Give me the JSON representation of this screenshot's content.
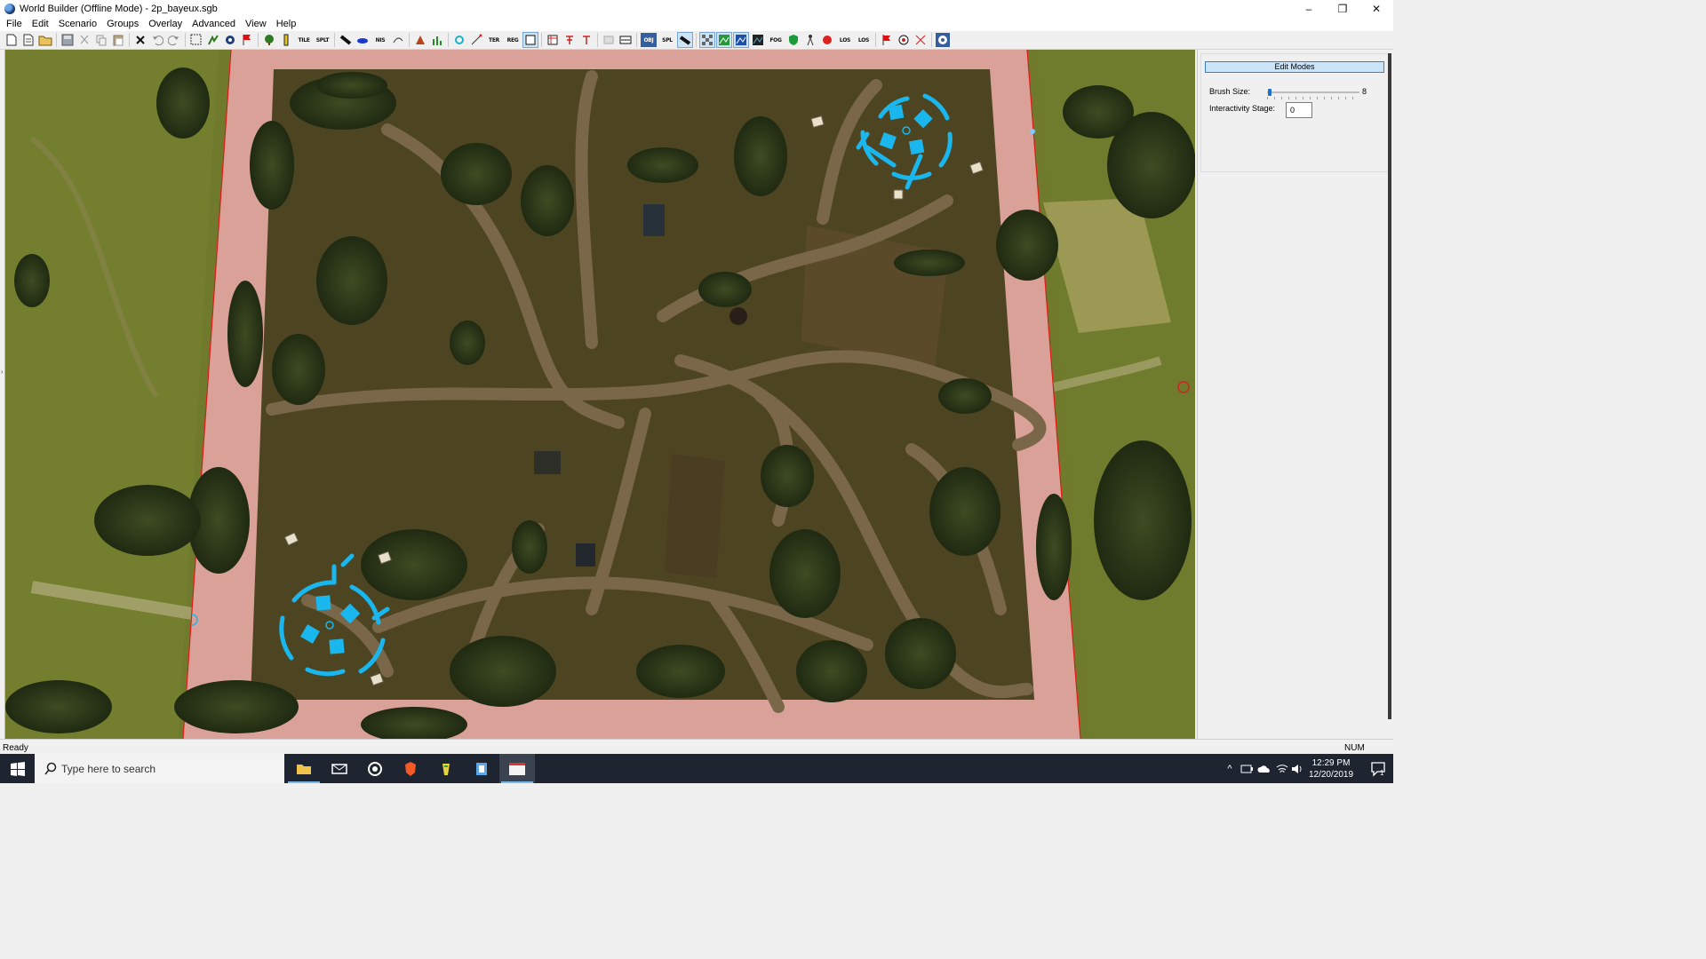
{
  "window": {
    "title": "World Builder (Offline Mode) - 2p_bayeux.sgb",
    "controls": {
      "minimize": "–",
      "maximize": "❐",
      "close": "✕"
    }
  },
  "menubar": {
    "items": [
      "File",
      "Edit",
      "Scenario",
      "Groups",
      "Overlay",
      "Advanced",
      "View",
      "Help"
    ]
  },
  "toolbar": {
    "text_buttons": {
      "tile": "TILE",
      "split": "SPLT",
      "nis": "NIS",
      "ter": "TER",
      "reg": "REG",
      "obj": "OBJ",
      "spl": "SPL",
      "fog": "FOG",
      "los1": "LOS",
      "los2": "LOS"
    }
  },
  "viewport": {
    "map_name": "2p_bayeux",
    "player_bases": 2
  },
  "panel": {
    "edit_modes_label": "Edit Modes",
    "brush_size_label": "Brush Size:",
    "brush_size_value": "8",
    "brush_size_fraction": 0.0,
    "interactivity_label": "Interactivity Stage:",
    "interactivity_value": "0"
  },
  "statusbar": {
    "status": "Ready",
    "num_lock": "NUM"
  },
  "taskbar": {
    "search_placeholder": "Type here to search",
    "time": "12:29 PM",
    "date": "12/20/2019",
    "notification_count": "1"
  },
  "colors": {
    "border_pink": "#dba29a",
    "base_marker": "#1ab7ee",
    "playable_terrain": "#4d4421",
    "road": "#7a6749",
    "outside_terrain": "#6f7a2c"
  }
}
